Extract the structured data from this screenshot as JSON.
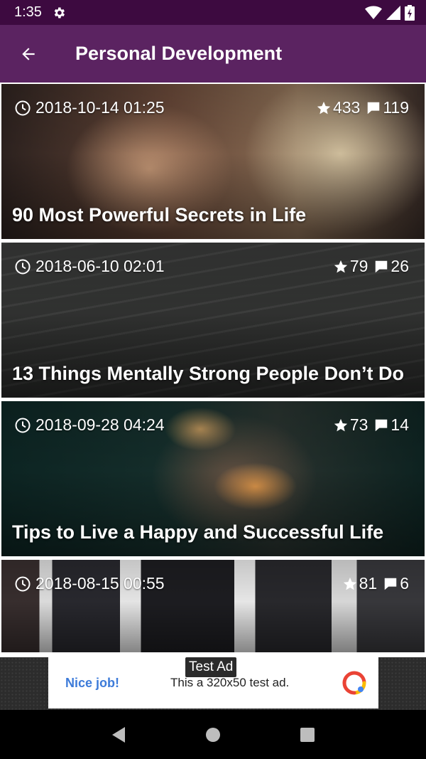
{
  "status_bar": {
    "time": "1:35",
    "icons": [
      "gear-icon",
      "wifi-icon",
      "signal-icon",
      "battery-icon"
    ]
  },
  "app_bar": {
    "title": "Personal Development",
    "back_icon": "arrow-back-icon"
  },
  "articles": [
    {
      "date": "2018-10-14 01:25",
      "stars": "433",
      "comments": "119",
      "title": "90 Most Powerful Secrets in Life",
      "colors": [
        "#3a2a26",
        "#8a6a52",
        "#c9b59a"
      ]
    },
    {
      "date": "2018-06-10 02:01",
      "stars": "79",
      "comments": "26",
      "title": "13 Things Mentally Strong People Don’t Do",
      "colors": [
        "#2a2c2b",
        "#4a4c4a",
        "#3a3b3a"
      ]
    },
    {
      "date": "2018-09-28 04:24",
      "stars": "73",
      "comments": "14",
      "title": "Tips to Live a Happy and Successful Life",
      "colors": [
        "#0f2a2a",
        "#3a3a30",
        "#1a2e2c"
      ]
    },
    {
      "date": "2018-08-15 00:55",
      "stars": "81",
      "comments": "6",
      "title": "",
      "colors": [
        "#d9d9d9",
        "#2a2a2c",
        "#bdbdbd"
      ]
    }
  ],
  "ad": {
    "badge": "Test Ad",
    "headline": "Nice job!",
    "body": "This a 320x50 test ad."
  },
  "nav": {
    "back": "nav-back-icon",
    "home": "nav-home-icon",
    "recents": "nav-recents-icon"
  }
}
